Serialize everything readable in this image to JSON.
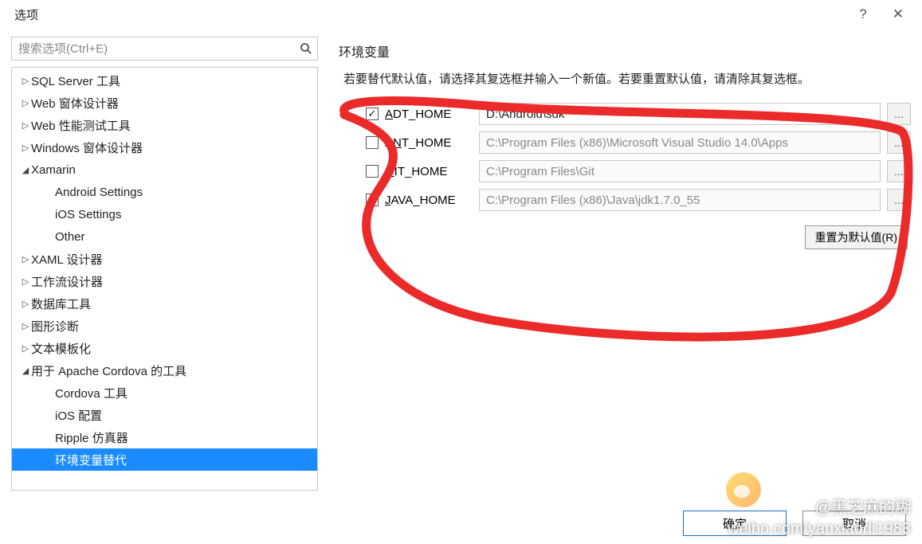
{
  "window": {
    "title": "选项",
    "help_icon": "?",
    "close_icon": "✕"
  },
  "search": {
    "placeholder": "搜索选项(Ctrl+E)"
  },
  "tree": {
    "items": [
      {
        "label": "SQL Server 工具",
        "level": 1,
        "twisty": "▷"
      },
      {
        "label": "Web 窗体设计器",
        "level": 1,
        "twisty": "▷"
      },
      {
        "label": "Web 性能测试工具",
        "level": 1,
        "twisty": "▷"
      },
      {
        "label": "Windows 窗体设计器",
        "level": 1,
        "twisty": "▷"
      },
      {
        "label": "Xamarin",
        "level": 1,
        "twisty": "◢"
      },
      {
        "label": "Android Settings",
        "level": 2,
        "twisty": ""
      },
      {
        "label": "iOS Settings",
        "level": 2,
        "twisty": ""
      },
      {
        "label": "Other",
        "level": 2,
        "twisty": ""
      },
      {
        "label": "XAML 设计器",
        "level": 1,
        "twisty": "▷"
      },
      {
        "label": "工作流设计器",
        "level": 1,
        "twisty": "▷"
      },
      {
        "label": "数据库工具",
        "level": 1,
        "twisty": "▷"
      },
      {
        "label": "图形诊断",
        "level": 1,
        "twisty": "▷"
      },
      {
        "label": "文本模板化",
        "level": 1,
        "twisty": "▷"
      },
      {
        "label": "用于 Apache Cordova 的工具",
        "level": 1,
        "twisty": "◢"
      },
      {
        "label": "Cordova 工具",
        "level": 2,
        "twisty": ""
      },
      {
        "label": "iOS 配置",
        "level": 2,
        "twisty": ""
      },
      {
        "label": "Ripple 仿真器",
        "level": 2,
        "twisty": ""
      },
      {
        "label": "环境变量替代",
        "level": 2,
        "twisty": "",
        "selected": true
      }
    ]
  },
  "env": {
    "title": "环境变量",
    "description": "若要替代默认值，请选择其复选框并输入一个新值。若要重置默认值，请清除其复选框。",
    "rows": [
      {
        "checked": true,
        "label_pre": "",
        "label_ul": "A",
        "label_post": "DT_HOME",
        "value": "D:\\Android\\sdk",
        "active": true
      },
      {
        "checked": false,
        "label_pre": "A",
        "label_ul": "N",
        "label_post": "T_HOME",
        "value": "C:\\Program Files (x86)\\Microsoft Visual Studio 14.0\\Apps",
        "active": false
      },
      {
        "checked": false,
        "label_pre": "",
        "label_ul": "G",
        "label_post": "IT_HOME",
        "value": "C:\\Program Files\\Git",
        "active": false
      },
      {
        "checked": false,
        "label_pre": "",
        "label_ul": "J",
        "label_post": "AVA_HOME",
        "value": "C:\\Program Files (x86)\\Java\\jdk1.7.0_55",
        "active": false
      }
    ],
    "browse_label": "...",
    "reset_label": "重置为默认值(R)"
  },
  "footer": {
    "ok": "确定",
    "cancel": "取消"
  },
  "watermark": {
    "line1": "@黑芝麻的糊",
    "line2": "weibo.com/yanxiaodi1983"
  }
}
